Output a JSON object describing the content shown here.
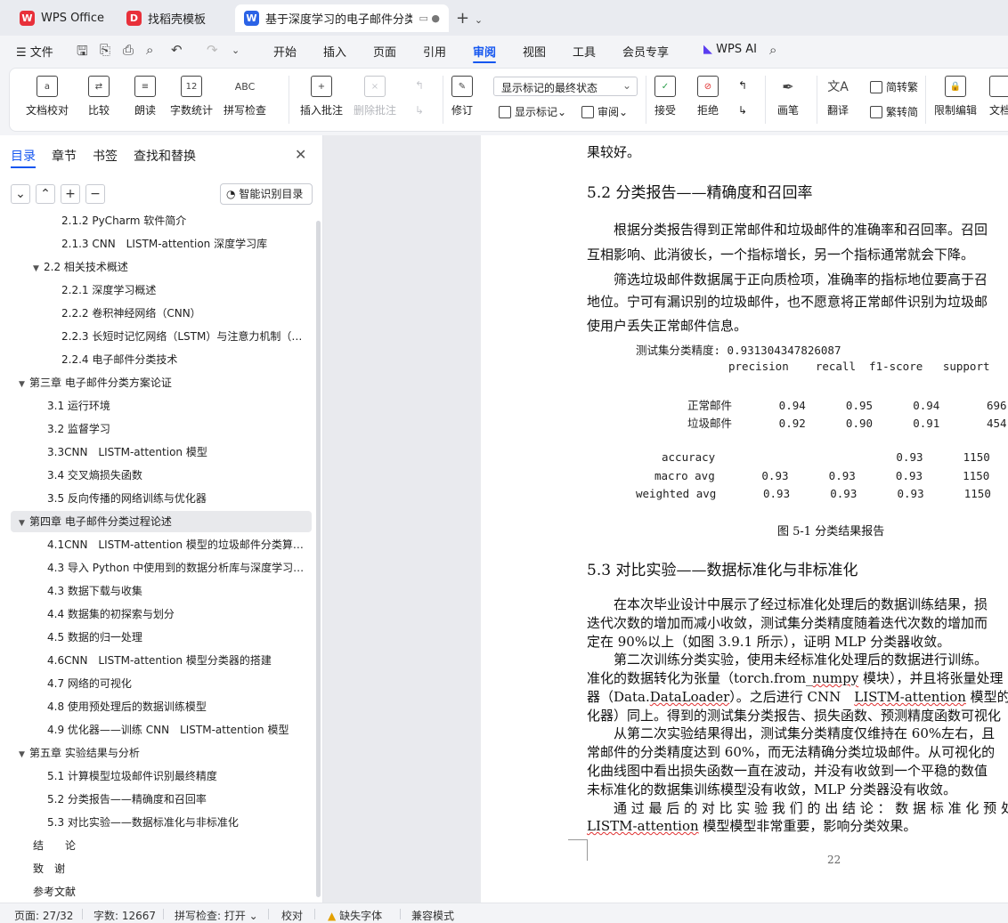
{
  "tabs": [
    {
      "label": "WPS Office",
      "logo": "W"
    },
    {
      "label": "找稻壳模板",
      "logo": "D"
    },
    {
      "label": "基于深度学习的电子邮件分类",
      "logo": "W"
    }
  ],
  "menu": {
    "file": "文件",
    "items": [
      "开始",
      "插入",
      "页面",
      "引用",
      "审阅",
      "视图",
      "工具",
      "会员专享"
    ],
    "wps_ai": "WPS AI"
  },
  "ribbon": {
    "doc_check": "文档校对",
    "compare": "比较",
    "read_aloud": "朗读",
    "word_count": "字数统计",
    "spell_check": "拼写检查",
    "insert_comment": "插入批注",
    "delete_comment": "删除批注",
    "revise": "修订",
    "markup_dropdown": "显示标记的最终状态",
    "show_markup": "显示标记",
    "review": "审阅",
    "accept": "接受",
    "reject": "拒绝",
    "pen": "画笔",
    "translate": "翻译",
    "trad": "简转繁",
    "simp": "繁转简",
    "restrict_edit": "限制编辑",
    "doc_more": "文档"
  },
  "sidebar": {
    "tabs": [
      "目录",
      "章节",
      "书签",
      "查找和替换"
    ],
    "smart_button": "智能识别目录",
    "toc": [
      {
        "label": "2.1.2 PyCharm 软件简介",
        "level": 3
      },
      {
        "label": "2.1.3 CNN　LISTM-attention 深度学习库",
        "level": 3
      },
      {
        "label": "2.2 相关技术概述",
        "level": 2,
        "expanded": true
      },
      {
        "label": "2.2.1 深度学习概述",
        "level": 3
      },
      {
        "label": "2.2.2 卷积神经网络（CNN）",
        "level": 3
      },
      {
        "label": "2.2.3 长短时记忆网络（LSTM）与注意力机制（…",
        "level": 3
      },
      {
        "label": "2.2.4 电子邮件分类技术",
        "level": 3
      },
      {
        "label": "第三章 电子邮件分类方案论证",
        "level": 1,
        "expanded": true
      },
      {
        "label": "3.1 运行环境",
        "level": 2
      },
      {
        "label": "3.2 监督学习",
        "level": 2
      },
      {
        "label": "3.3CNN　LISTM-attention 模型",
        "level": 2
      },
      {
        "label": "3.4 交叉熵损失函数",
        "level": 2
      },
      {
        "label": "3.5 反向传播的网络训练与优化器",
        "level": 2
      },
      {
        "label": "第四章 电子邮件分类过程论述",
        "level": 1,
        "expanded": true,
        "selected": true
      },
      {
        "label": "4.1CNN　LISTM-attention 模型的垃圾邮件分类算…",
        "level": 2
      },
      {
        "label": "4.3 导入 Python 中使用到的数据分析库与深度学习…",
        "level": 2
      },
      {
        "label": "4.3 数据下载与收集",
        "level": 2
      },
      {
        "label": "4.4 数据集的初探索与划分",
        "level": 2
      },
      {
        "label": "4.5 数据的归一处理",
        "level": 2
      },
      {
        "label": "4.6CNN　LISTM-attention 模型分类器的搭建",
        "level": 2
      },
      {
        "label": "4.7 网络的可视化",
        "level": 2
      },
      {
        "label": "4.8 使用预处理后的数据训练模型",
        "level": 2
      },
      {
        "label": "4.9 优化器——训练 CNN　LISTM-attention 模型",
        "level": 2
      },
      {
        "label": "第五章 实验结果与分析",
        "level": 1,
        "expanded": true
      },
      {
        "label": "5.1 计算模型垃圾邮件识别最终精度",
        "level": 2
      },
      {
        "label": "5.2 分类报告——精确度和召回率",
        "level": 2
      },
      {
        "label": "5.3 对比实验——数据标准化与非标准化",
        "level": 2
      },
      {
        "label": "结　　论",
        "level": 1
      },
      {
        "label": "致　谢",
        "level": 1
      },
      {
        "label": "参考文献",
        "level": 1
      }
    ]
  },
  "document": {
    "top_fragment": "果较好。",
    "h_52": "5.2 分类报告——精确度和召回率",
    "p1_l1": "根据分类报告得到正常邮件和垃圾邮件的准确率和召回率。召回",
    "p1_l2": "互相影响、此消彼长，一个指标增长，另一个指标通常就会下降。",
    "p2_l1": "筛选垃圾邮件数据属于正向质检项，准确率的指标地位要高于召",
    "p2_l2": "地位。宁可有漏识别的垃圾邮件，也不愿意将正常邮件识别为垃圾邮",
    "p2_l3": "使用户丢失正常邮件信息。",
    "report": {
      "accuracy_line": "测试集分类精度: 0.931304347826087",
      "header": "precision    recall  f1-score   support",
      "rows": [
        "正常邮件       0.94      0.95      0.94       696",
        "垃圾邮件       0.92      0.90      0.91       454",
        "accuracy                           0.93      1150",
        "macro avg       0.93      0.93      0.93      1150",
        "weighted avg       0.93      0.93      0.93      1150"
      ]
    },
    "caption": "图 5-1 分类结果报告",
    "h_53": "5.3 对比实验——数据标准化与非标准化",
    "p3_l1": "在本次毕业设计中展示了经过标准化处理后的数据训练结果，损",
    "p3_l2": "迭代次数的增加而减小收敛，测试集分类精度随着迭代次数的增加而",
    "p3_l3": "定在 90%以上（如图 3.9.1 所示），证明 MLP 分类器收敛。",
    "p4_l1": "第二次训练分类实验，使用未经标准化处理后的数据进行训练。",
    "p4_l2a": "准化的数据转化为张量（torch.from_",
    "p4_l2b": "numpy",
    "p4_l2c": " 模块），并且将张量处理",
    "p4_l3a": "器（Data.",
    "p4_l3b": "DataLoader",
    "p4_l3c": "）。之后进行 CNN　",
    "p4_l3d": "LISTM-attention",
    "p4_l3e": " 模型的搭建",
    "p4_l4": "化器）同上。得到的测试集分类报告、损失函数、预测精度函数可视化",
    "p5_l1": "从第二次实验结果得出，测试集分类精度仅维持在 60%左右，且",
    "p5_l2": "常邮件的分类精度达到 60%，而无法精确分类垃圾邮件。从可视化的",
    "p5_l3": "化曲线图中看出损失函数一直在波动，并没有收敛到一个平稳的数值",
    "p5_l4": "未标准化的数据集训练模型没有收敛，MLP 分类器没有收敛。",
    "p6_l1": "通 过 最 后 的 对 比 实 验 我 们 的 出 结 论 ： 数 据 标 准 化 预 处",
    "p6_l2a": "LISTM-attention",
    "p6_l2b": " 模型模型非常重要，影响分类效果。",
    "page_number": "22"
  },
  "status": {
    "page": "页面: 27/32",
    "words": "字数: 12667",
    "spell": "拼写检查: 打开",
    "proof": "校对",
    "missing_font": "缺失字体",
    "compat": "兼容模式"
  }
}
